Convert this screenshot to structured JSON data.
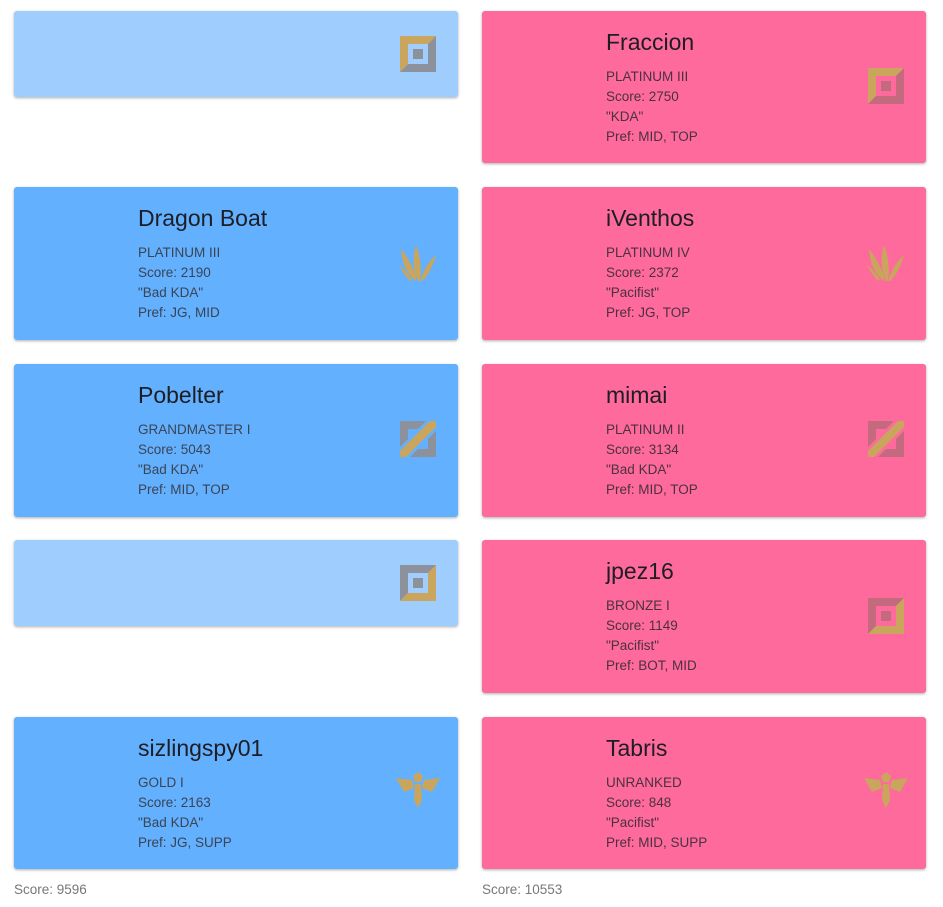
{
  "blue_team": {
    "players": [
      {
        "empty": true,
        "role_icon": "top-lane-icon"
      },
      {
        "name": "Dragon Boat",
        "rank": "PLATINUM III",
        "score": "Score: 2190",
        "tag": "\"Bad KDA\"",
        "pref": "Pref: JG, MID",
        "role_icon": "jungle-icon"
      },
      {
        "name": "Pobelter",
        "rank": "GRANDMASTER I",
        "score": "Score: 5043",
        "tag": "\"Bad KDA\"",
        "pref": "Pref: MID, TOP",
        "role_icon": "mid-lane-icon"
      },
      {
        "empty": true,
        "role_icon": "bot-lane-icon"
      },
      {
        "name": "sizlingspy01",
        "rank": "GOLD I",
        "score": "Score: 2163",
        "tag": "\"Bad KDA\"",
        "pref": "Pref: JG, SUPP",
        "role_icon": "support-icon"
      }
    ],
    "total_score": "Score: 9596"
  },
  "red_team": {
    "players": [
      {
        "name": "Fraccion",
        "rank": "PLATINUM III",
        "score": "Score: 2750",
        "tag": "\"KDA\"",
        "pref": "Pref: MID, TOP",
        "role_icon": "top-lane-icon"
      },
      {
        "name": "iVenthos",
        "rank": "PLATINUM IV",
        "score": "Score: 2372",
        "tag": "\"Pacifist\"",
        "pref": "Pref: JG, TOP",
        "role_icon": "jungle-icon"
      },
      {
        "name": "mimai",
        "rank": "PLATINUM II",
        "score": "Score: 3134",
        "tag": "\"Bad KDA\"",
        "pref": "Pref: MID, TOP",
        "role_icon": "mid-lane-icon"
      },
      {
        "name": "jpez16",
        "rank": "BRONZE I",
        "score": "Score: 1149",
        "tag": "\"Pacifist\"",
        "pref": "Pref: BOT, MID",
        "role_icon": "bot-lane-icon"
      },
      {
        "name": "Tabris",
        "rank": "UNRANKED",
        "score": "Score: 848",
        "tag": "\"Pacifist\"",
        "pref": "Pref: MID, SUPP",
        "role_icon": "support-icon"
      }
    ],
    "total_score": "Score: 10553"
  },
  "colors": {
    "blue_card": "#63b0fe",
    "blue_empty_card": "#9fcdfd",
    "red_card": "#fe6a9b",
    "icon_gold": "#c9a55d",
    "icon_gray": "#8c919c"
  }
}
